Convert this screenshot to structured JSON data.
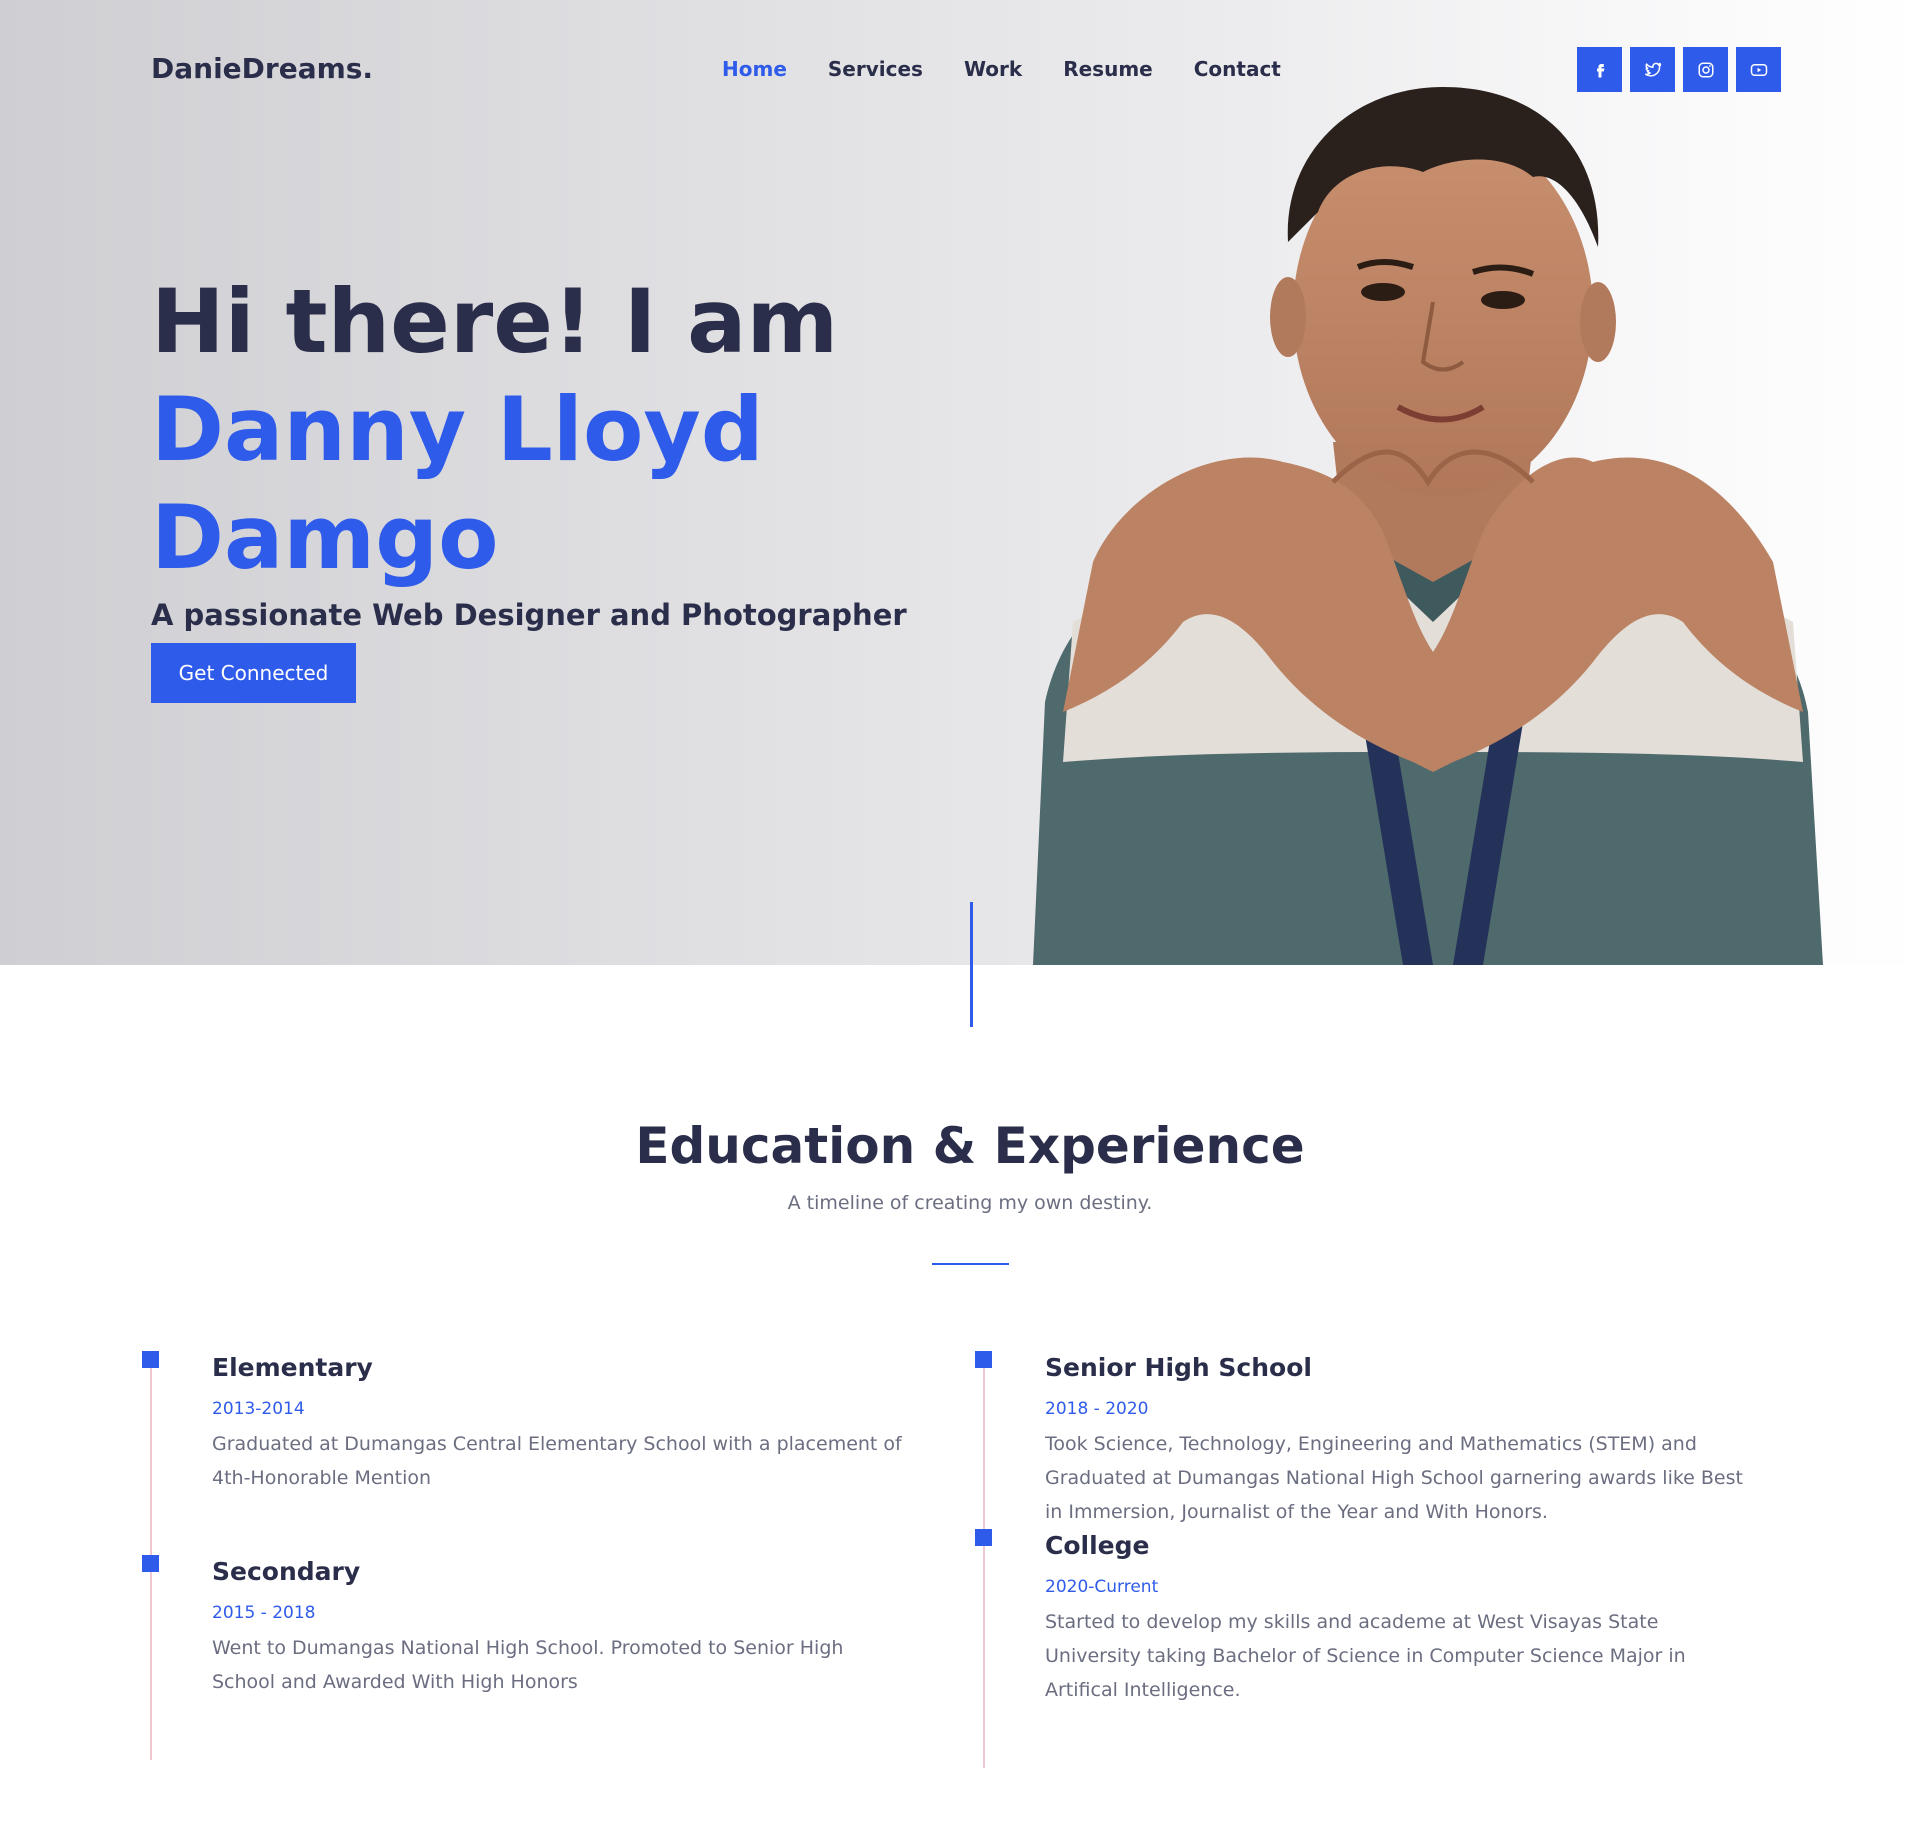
{
  "brand": {
    "logo": "DanieDreams."
  },
  "nav": {
    "items": [
      {
        "label": "Home",
        "active": true
      },
      {
        "label": "Services",
        "active": false
      },
      {
        "label": "Work",
        "active": false
      },
      {
        "label": "Resume",
        "active": false
      },
      {
        "label": "Contact",
        "active": false
      }
    ]
  },
  "social": [
    "facebook-icon",
    "twitter-icon",
    "instagram-icon",
    "youtube-icon"
  ],
  "hero": {
    "greeting": "Hi there! I am",
    "name": "Danny Lloyd Damgo",
    "tagline": "A passionate Web Designer and Photographer",
    "cta_label": "Get Connected"
  },
  "education": {
    "title": "Education & Experience",
    "subtitle": "A timeline of creating my own destiny.",
    "items": [
      {
        "title": "Elementary",
        "date": "2013-2014",
        "desc": "Graduated at Dumangas Central Elementary School with a placement of 4th-Honorable Mention"
      },
      {
        "title": "Secondary",
        "date": "2015 - 2018",
        "desc": "Went to Dumangas National High School. Promoted to Senior High School and Awarded With High Honors"
      },
      {
        "title": "Senior High School",
        "date": "2018 - 2020",
        "desc": "Took Science, Technology, Engineering and Mathematics (STEM) and Graduated at Dumangas National High School garnering awards like Best in Immersion, Journalist of the Year and With Honors."
      },
      {
        "title": "College",
        "date": "2020-Current",
        "desc": "Started to develop my skills and academe at West Visayas State University taking Bachelor of Science in Computer Science Major in Artifical Intelligence."
      }
    ]
  },
  "colors": {
    "accent": "#2f5bea",
    "heading": "#2b2e4a",
    "body": "#6b6e80",
    "timeline": "#f1c6cf"
  }
}
